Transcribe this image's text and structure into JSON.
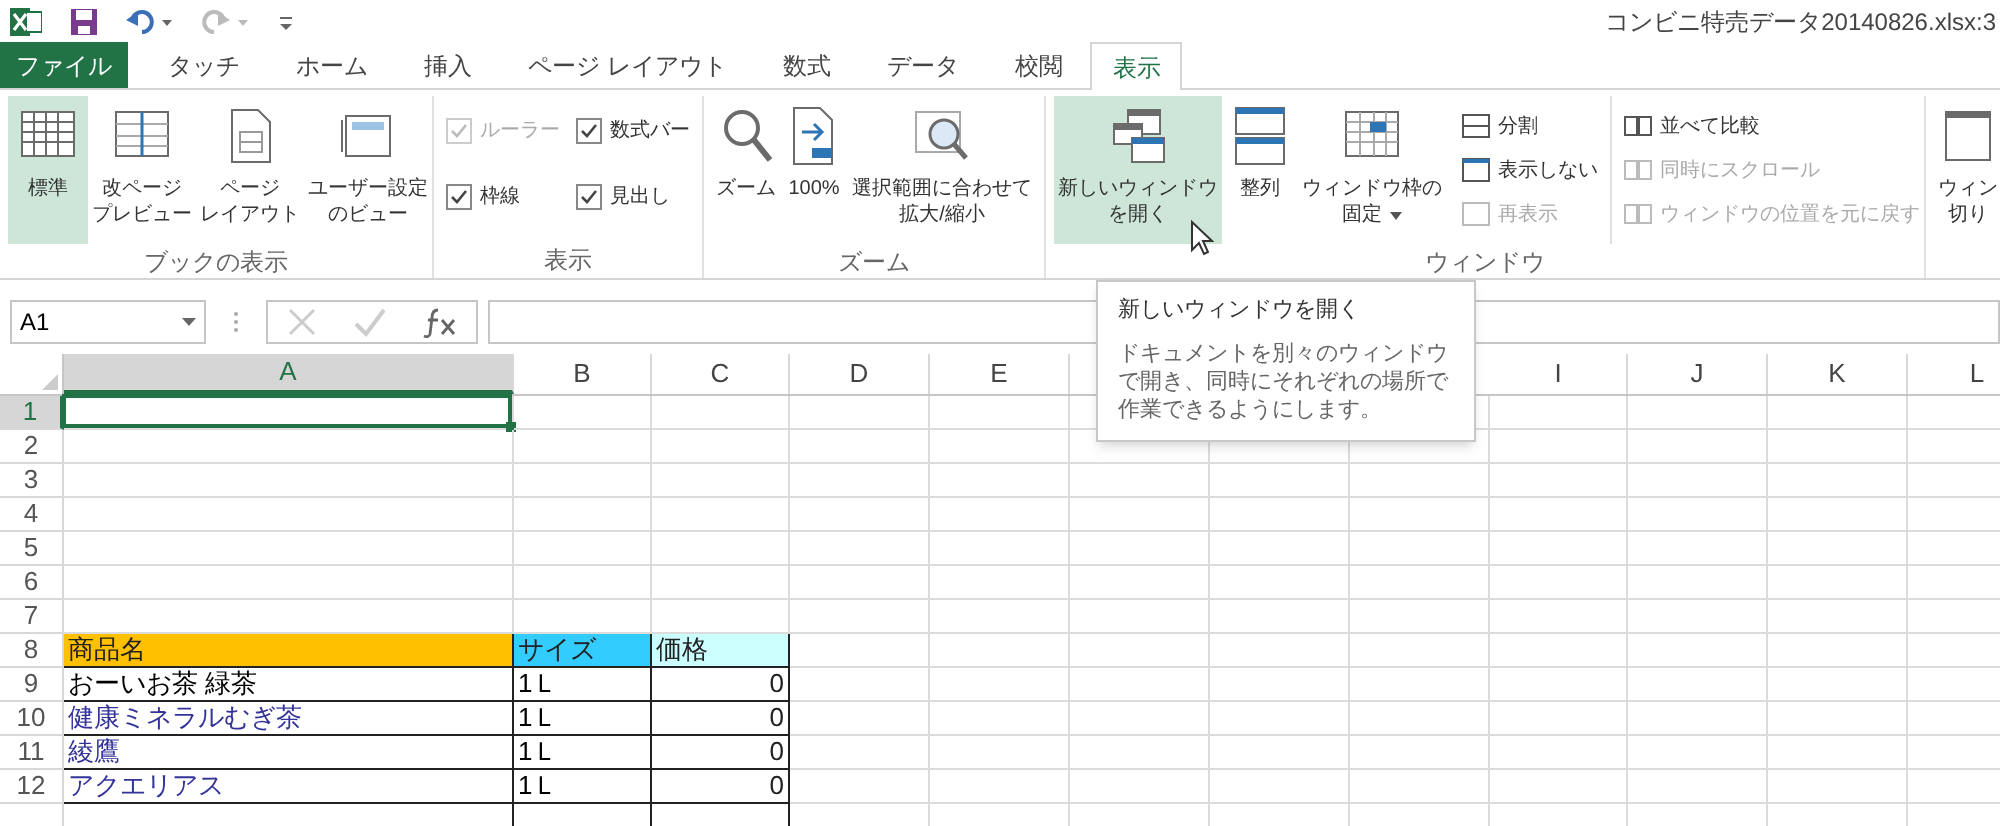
{
  "window": {
    "title": "コンビニ特売データ20140826.xlsx:3"
  },
  "tabs": [
    {
      "label": "ファイル",
      "kind": "file",
      "selected": false
    },
    {
      "label": "タッチ",
      "kind": "tab",
      "selected": false
    },
    {
      "label": "ホーム",
      "kind": "tab",
      "selected": false
    },
    {
      "label": "挿入",
      "kind": "tab",
      "selected": false
    },
    {
      "label": "ページ レイアウト",
      "kind": "tab",
      "selected": false
    },
    {
      "label": "数式",
      "kind": "tab",
      "selected": false
    },
    {
      "label": "データ",
      "kind": "tab",
      "selected": false
    },
    {
      "label": "校閲",
      "kind": "tab",
      "selected": false
    },
    {
      "label": "表示",
      "kind": "tab",
      "selected": true
    }
  ],
  "ribbon": {
    "groups": [
      {
        "kind": "views",
        "label": "ブックの表示",
        "buttons": [
          {
            "lines": [
              "標準"
            ],
            "selected": true
          },
          {
            "lines": [
              "改ページ",
              "プレビュー"
            ],
            "selected": false
          },
          {
            "lines": [
              "ページ",
              "レイアウト"
            ],
            "selected": false
          },
          {
            "lines": [
              "ユーザー設定",
              "のビュー"
            ],
            "selected": false
          }
        ]
      },
      {
        "kind": "checks",
        "label": "表示",
        "checkboxes": [
          {
            "label": "ルーラー",
            "checked": true,
            "disabled": true
          },
          {
            "label": "数式バー",
            "checked": true,
            "disabled": false
          },
          {
            "label": "枠線",
            "checked": true,
            "disabled": false
          },
          {
            "label": "見出し",
            "checked": true,
            "disabled": false
          }
        ]
      },
      {
        "kind": "zoom",
        "label": "ズーム",
        "buttons": [
          {
            "lines": [
              "ズーム"
            ]
          },
          {
            "lines": [
              "100%"
            ]
          },
          {
            "lines": [
              "選択範囲に合わせて",
              "拡大/縮小"
            ]
          }
        ]
      },
      {
        "kind": "window",
        "label": "ウィンドウ",
        "buttons": [
          {
            "lines": [
              "新しいウィンドウ",
              "を開く"
            ],
            "hovered": true,
            "dropdown": false
          },
          {
            "lines": [
              "整列"
            ],
            "hovered": false,
            "dropdown": false
          },
          {
            "lines": [
              "ウィンドウ枠の",
              "固定"
            ],
            "hovered": false,
            "dropdown": true
          }
        ],
        "small_columns": [
          [
            {
              "label": "分割",
              "disabled": false
            },
            {
              "label": "表示しない",
              "disabled": false
            },
            {
              "label": "再表示",
              "disabled": true
            }
          ],
          [
            {
              "label": "並べて比較",
              "disabled": false
            },
            {
              "label": "同時にスクロール",
              "disabled": true
            },
            {
              "label": "ウィンドウの位置を元に戻す",
              "disabled": true
            }
          ]
        ]
      },
      {
        "kind": "partial",
        "lines": [
          "ウィン",
          "切り"
        ]
      }
    ]
  },
  "formula_bar": {
    "name_box": "A1"
  },
  "tooltip": {
    "title": "新しいウィンドウを開く",
    "body": "ドキュメントを別々のウィンドウで開き、同時にそれぞれの場所で作業できるようにします。"
  },
  "sheet": {
    "columns": [
      {
        "label": "A",
        "selected": true
      },
      {
        "label": "B",
        "selected": false
      },
      {
        "label": "C",
        "selected": false
      },
      {
        "label": "D",
        "selected": false
      },
      {
        "label": "E",
        "selected": false
      },
      null,
      null,
      null,
      {
        "label": "I",
        "selected": false
      },
      {
        "label": "J",
        "selected": false
      },
      {
        "label": "K",
        "selected": false
      },
      {
        "label": "L",
        "selected": false
      }
    ],
    "rows": [
      {
        "number": "1",
        "selected": true
      },
      {
        "number": "2",
        "selected": false
      },
      {
        "number": "3",
        "selected": false
      },
      {
        "number": "4",
        "selected": false
      },
      {
        "number": "5",
        "selected": false
      },
      {
        "number": "6",
        "selected": false
      },
      {
        "number": "7",
        "selected": false
      },
      {
        "number": "8",
        "selected": false,
        "cells": [
          {
            "kind": "header",
            "text": "商品名",
            "color": "#ffc000"
          },
          {
            "kind": "header",
            "text": "サイズ",
            "color": "#33ccff"
          },
          {
            "kind": "header",
            "text": "価格",
            "color": "#ccffff"
          }
        ]
      },
      {
        "number": "9",
        "selected": false,
        "cells": [
          {
            "kind": "text",
            "text": "おーいお茶 緑茶",
            "color": "#000000"
          },
          {
            "kind": "text",
            "text": "1Ｌ",
            "color": "#000000"
          },
          {
            "kind": "number",
            "text": "0"
          }
        ]
      },
      {
        "number": "10",
        "selected": false,
        "cells": [
          {
            "kind": "text",
            "text": "健康ミネラルむぎ茶",
            "color": "#333399"
          },
          {
            "kind": "text",
            "text": "1Ｌ",
            "color": "#000000"
          },
          {
            "kind": "number",
            "text": "0"
          }
        ]
      },
      {
        "number": "11",
        "selected": false,
        "cells": [
          {
            "kind": "text",
            "text": "綾鷹",
            "color": "#333399"
          },
          {
            "kind": "text",
            "text": "1Ｌ",
            "color": "#000000"
          },
          {
            "kind": "number",
            "text": "0"
          }
        ]
      },
      {
        "number": "12",
        "selected": false,
        "cells": [
          {
            "kind": "text",
            "text": "アクエリアス",
            "color": "#333399"
          },
          {
            "kind": "text",
            "text": "1Ｌ",
            "color": "#000000"
          },
          {
            "kind": "number",
            "text": "0"
          }
        ]
      }
    ]
  }
}
